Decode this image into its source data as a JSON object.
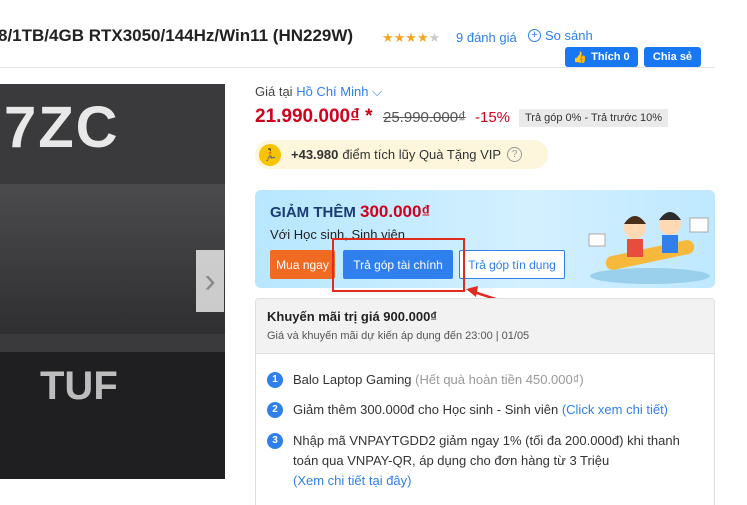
{
  "header": {
    "title": "8/1TB/4GB RTX3050/144Hz/Win11 (HN229W)",
    "stars_filled": "★★★★",
    "stars_empty": "★",
    "rating_count": "9 đánh giá",
    "compare": "So sánh",
    "like_label": "Thích 0",
    "share_label": "Chia sẻ"
  },
  "product_image": {
    "big_text": "7ZC",
    "brand_text": "TUF",
    "next_arrow": "›"
  },
  "price_block": {
    "location_prefix": "Giá tại",
    "location_city": "Hồ Chí Minh",
    "price": "21.990.000₫ *",
    "old_price": "25.990.000₫",
    "discount": "-15%",
    "installment_tag": "Trả góp 0% - Trả trước 10%",
    "vip_points": "+43.980",
    "vip_text": "điểm tích lũy Quà Tặng VIP"
  },
  "student_banner": {
    "title": "GIẢM THÊM",
    "amount": "300.000₫",
    "subtitle": "Với Học sinh, Sinh viên",
    "buy_now": "Mua ngay",
    "finance_installment": "Trả góp tài chính",
    "card_installment": "Trả góp tín dụng"
  },
  "promotions": {
    "title": "Khuyến mãi trị giá 900.000₫",
    "note": "Giá và khuyến mãi dự kiến áp dụng đến 23:00 | 01/05",
    "items": [
      {
        "num": "1",
        "text": "Balo Laptop Gaming",
        "extra": "(Hết quà hoàn tiền 450.000₫)"
      },
      {
        "num": "2",
        "text": "Giảm thêm 300.000đ cho Học sinh - Sinh viên",
        "link": "(Click xem chi tiết)"
      },
      {
        "num": "3",
        "text": "Nhập mã VNPAYTGDD2 giảm ngay 1% (tối đa 200.000đ) khi thanh toán qua VNPAY-QR, áp dụng cho đơn hàng từ 3 Triệu",
        "link": "(Xem chi tiết tại đây)"
      }
    ]
  },
  "colors": {
    "accent_blue": "#2f80ed",
    "price_red": "#d0021b",
    "buy_orange": "#f06a21",
    "highlight_red": "#e02b20"
  }
}
